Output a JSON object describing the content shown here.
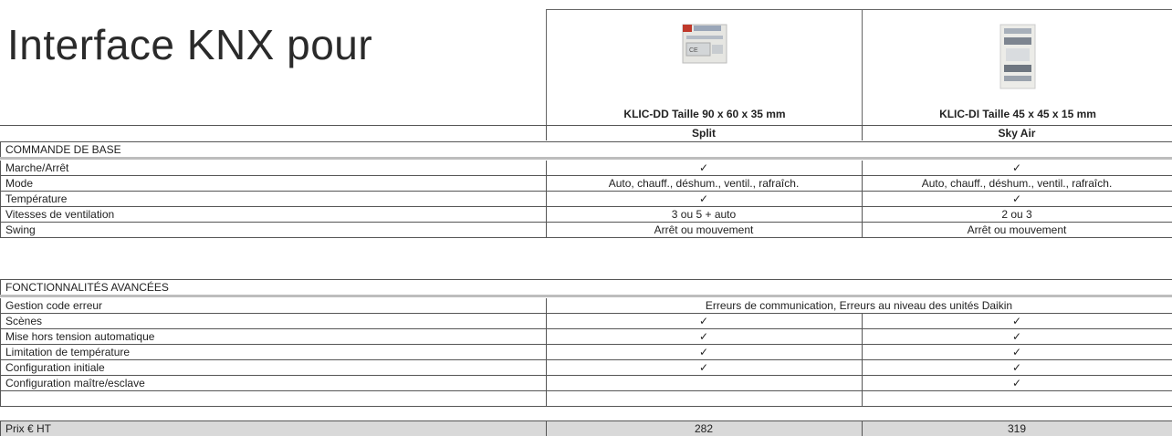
{
  "title": "Interface KNX pour",
  "products": [
    {
      "caption": "KLIC-DD  Taille 90 x 60 x 35 mm",
      "type": "Split"
    },
    {
      "caption": "KLIC-DI  Taille 45 x 45 x 15 mm",
      "type": "Sky Air"
    }
  ],
  "section1": {
    "header": "COMMANDE DE BASE",
    "rows": [
      {
        "label": "Marche/Arrêt",
        "v1": "✓",
        "v2": "✓"
      },
      {
        "label": "Mode",
        "v1": "Auto, chauff., déshum., ventil., rafraîch.",
        "v2": "Auto, chauff., déshum., ventil., rafraîch."
      },
      {
        "label": "Température",
        "v1": "✓",
        "v2": "✓"
      },
      {
        "label": "Vitesses de ventilation",
        "v1": "3 ou 5 + auto",
        "v2": "2 ou 3"
      },
      {
        "label": "Swing",
        "v1": "Arrêt ou mouvement",
        "v2": "Arrêt ou mouvement"
      }
    ]
  },
  "section2": {
    "header": "FONCTIONNALITÉS AVANCÉES",
    "error_row": {
      "label": "Gestion code erreur",
      "value": "Erreurs de communication, Erreurs au niveau des unités Daikin"
    },
    "rows": [
      {
        "label": "Scènes",
        "v1": "✓",
        "v2": "✓"
      },
      {
        "label": "Mise hors tension automatique",
        "v1": "✓",
        "v2": "✓"
      },
      {
        "label": "Limitation de température",
        "v1": "✓",
        "v2": "✓"
      },
      {
        "label": "Configuration initiale",
        "v1": "✓",
        "v2": "✓"
      },
      {
        "label": "Configuration maître/esclave",
        "v1": "",
        "v2": "✓"
      }
    ]
  },
  "price": {
    "label": "Prix € HT",
    "v1": "282",
    "v2": "319"
  }
}
